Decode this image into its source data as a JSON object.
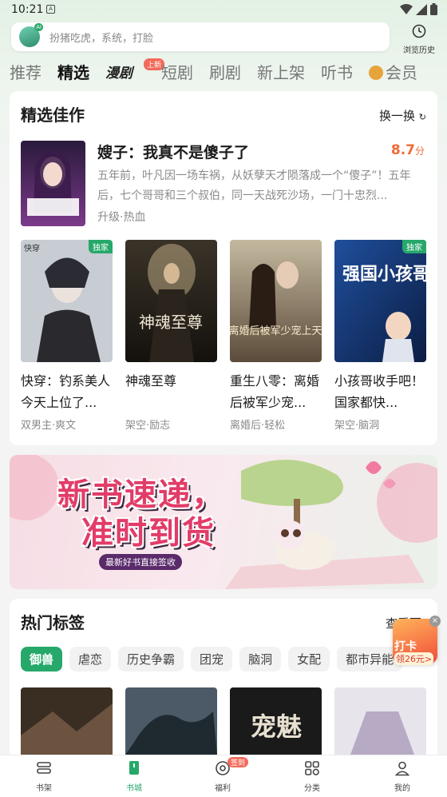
{
  "status_bar": {
    "time": "10:21",
    "badge": "A"
  },
  "search": {
    "placeholder": "扮猪吃虎，系统，打脸",
    "history_label": "浏览历史"
  },
  "tabs": [
    {
      "label": "推荐"
    },
    {
      "label": "精选"
    },
    {
      "label": "漫剧",
      "badge": "上新"
    },
    {
      "label": "短剧"
    },
    {
      "label": "刷剧"
    },
    {
      "label": "新上架"
    },
    {
      "label": "听书"
    },
    {
      "label": "会员"
    }
  ],
  "featured": {
    "title": "精选佳作",
    "more": "换一换",
    "hero": {
      "title": "嫂子：我真不是傻子了",
      "score": "8.7",
      "score_unit": "分",
      "desc": "五年前，叶凡因一场车祸，从妖孽天才陨落成一个“傻子”！五年后，七个哥哥和三个叔伯，同一天战死沙场，一门十忠烈...",
      "tags": "升级·热血"
    },
    "books": [
      {
        "title": "快穿：钓系美人今天上位了...",
        "tags": "双男主·爽文",
        "badge": "独家"
      },
      {
        "title": "神魂至尊",
        "tags": "架空·励志",
        "badge": ""
      },
      {
        "title": "重生八零：离婚后被军少宠...",
        "tags": "离婚后·轻松",
        "badge": ""
      },
      {
        "title": "小孩哥收手吧！国家都快...",
        "tags": "架空·脑洞",
        "badge": "独家"
      }
    ],
    "cover_text": [
      "快穿",
      "神魂至尊",
      "离婚后被军少宠上天",
      "强国小孩哥"
    ]
  },
  "banner": {
    "title_line1": "新书速递，",
    "title_line2": "准时到货",
    "subtitle": "最新好书直接签收"
  },
  "hot_tags": {
    "title": "热门标签",
    "more": "查看更",
    "tags": [
      "御兽",
      "虐恋",
      "历史争霸",
      "团宠",
      "脑洞",
      "女配",
      "都市异能"
    ],
    "thumb_text": "宠魅"
  },
  "promo": {
    "line1": "打卡",
    "line2": "领26元>"
  },
  "bottom_nav": [
    {
      "label": "书架"
    },
    {
      "label": "书城"
    },
    {
      "label": "福利",
      "badge": "签到"
    },
    {
      "label": "分类"
    },
    {
      "label": "我的"
    }
  ],
  "colors": {
    "accent": "#27a86b",
    "score": "#ef6a36",
    "badge_red": "#f36a5a"
  },
  "icons": [
    "wifi-icon",
    "signal-icon",
    "battery-icon",
    "clock-icon",
    "refresh-icon",
    "shelf-icon",
    "bookstore-icon",
    "welfare-icon",
    "category-icon",
    "profile-icon"
  ]
}
